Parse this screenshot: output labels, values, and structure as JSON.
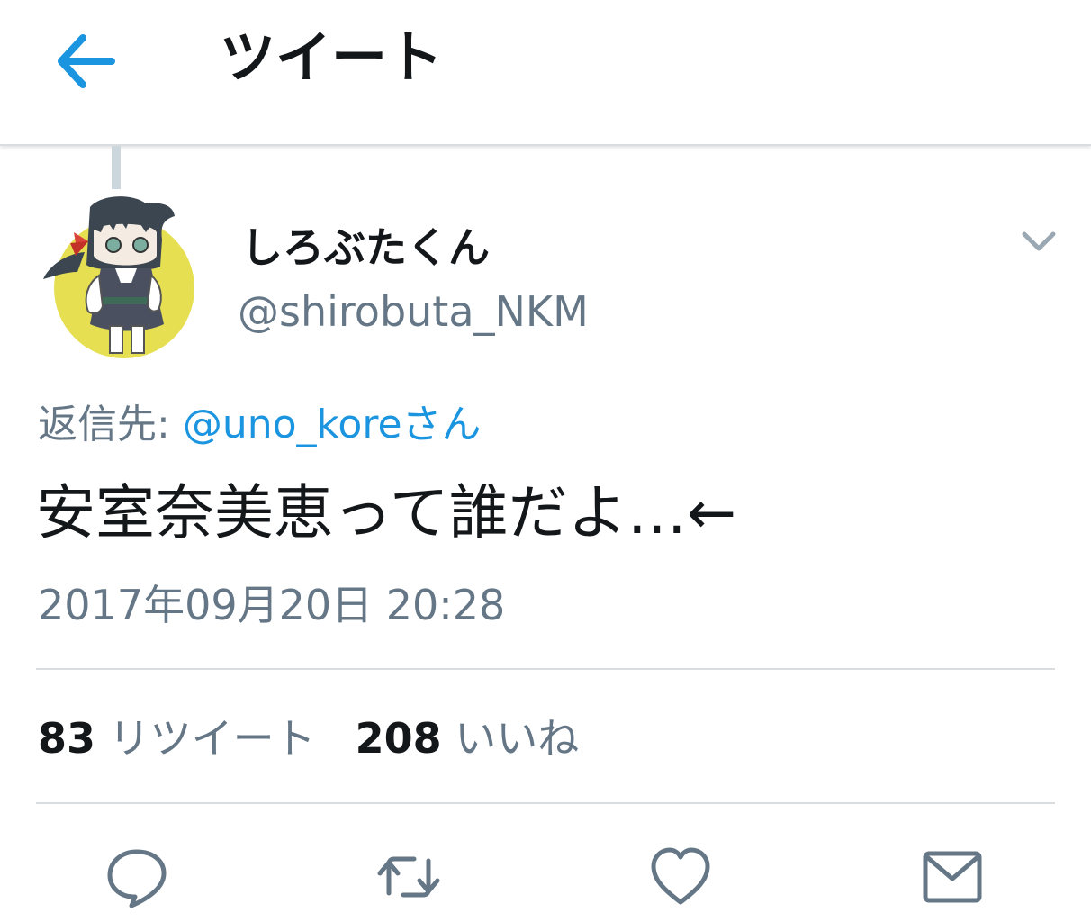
{
  "header": {
    "title": "ツイート",
    "back_icon": "arrow-left-icon"
  },
  "tweet": {
    "display_name": "しろぶたくん",
    "handle": "@shirobuta_NKM",
    "reply_prefix": "返信先: ",
    "reply_target": "@uno_koreさん",
    "text": "安室奈美恵って誰だよ…←",
    "timestamp": "2017年09月20日 20:28",
    "menu_icon": "chevron-down-icon"
  },
  "stats": {
    "retweet_count": "83",
    "retweet_label": "リツイート",
    "like_count": "208",
    "like_label": "いいね"
  },
  "actions": [
    "reply-icon",
    "retweet-icon",
    "heart-icon",
    "envelope-icon"
  ],
  "colors": {
    "accent": "#1b95e0",
    "icon": "#657786",
    "text": "#14171a",
    "muted": "#657786",
    "avatar_bg": "#e6df52"
  }
}
